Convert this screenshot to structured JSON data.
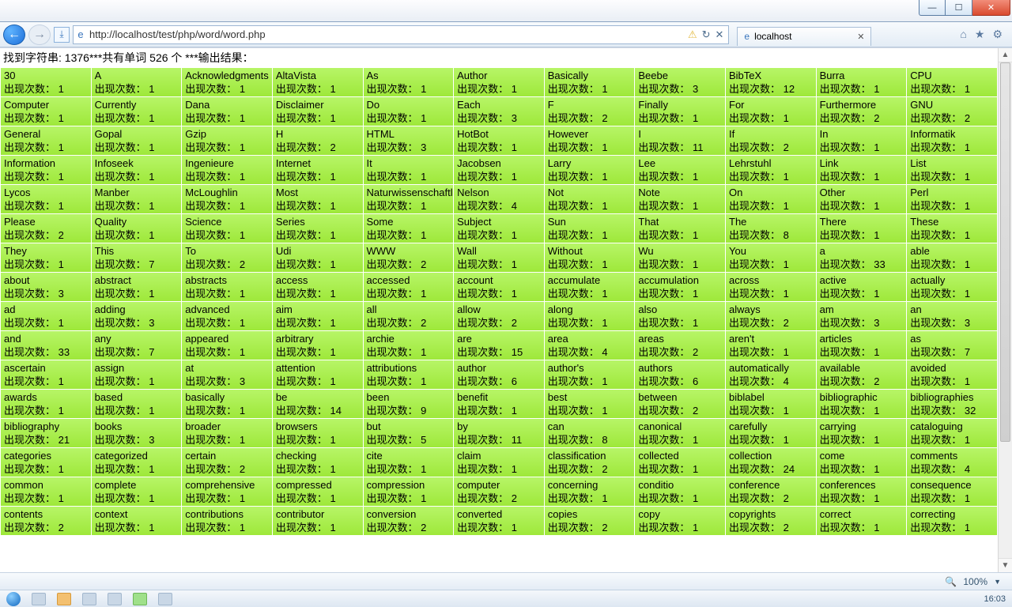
{
  "window": {
    "url": "http://localhost/test/php/word/word.php",
    "tab_title": "localhost",
    "zoom": "100%",
    "time": "16:03"
  },
  "page": {
    "header_prefix": "找到字符串: ",
    "char_count": "1376",
    "mid1": "***共有单词 ",
    "word_count": "526",
    "mid2": " 个 ***输出结果：",
    "count_label": "出现次数："
  },
  "words": [
    {
      "w": "30",
      "c": 1
    },
    {
      "w": "A",
      "c": 1
    },
    {
      "w": "Acknowledgments",
      "c": 1
    },
    {
      "w": "AltaVista",
      "c": 1
    },
    {
      "w": "As",
      "c": 1
    },
    {
      "w": "Author",
      "c": 1
    },
    {
      "w": "Basically",
      "c": 1
    },
    {
      "w": "Beebe",
      "c": 3
    },
    {
      "w": "BibTeX",
      "c": 12
    },
    {
      "w": "Burra",
      "c": 1
    },
    {
      "w": "CPU",
      "c": 1
    },
    {
      "w": "Computer",
      "c": 1
    },
    {
      "w": "Currently",
      "c": 1
    },
    {
      "w": "Dana",
      "c": 1
    },
    {
      "w": "Disclaimer",
      "c": 1
    },
    {
      "w": "Do",
      "c": 1
    },
    {
      "w": "Each",
      "c": 3
    },
    {
      "w": "F",
      "c": 2
    },
    {
      "w": "Finally",
      "c": 1
    },
    {
      "w": "For",
      "c": 1
    },
    {
      "w": "Furthermore",
      "c": 2
    },
    {
      "w": "GNU",
      "c": 2
    },
    {
      "w": "General",
      "c": 1
    },
    {
      "w": "Gopal",
      "c": 1
    },
    {
      "w": "Gzip",
      "c": 1
    },
    {
      "w": "H",
      "c": 2
    },
    {
      "w": "HTML",
      "c": 3
    },
    {
      "w": "HotBot",
      "c": 1
    },
    {
      "w": "However",
      "c": 1
    },
    {
      "w": "I",
      "c": 11
    },
    {
      "w": "If",
      "c": 2
    },
    {
      "w": "In",
      "c": 1
    },
    {
      "w": "Informatik",
      "c": 1
    },
    {
      "w": "Information",
      "c": 1
    },
    {
      "w": "Infoseek",
      "c": 1
    },
    {
      "w": "Ingenieure",
      "c": 1
    },
    {
      "w": "Internet",
      "c": 1
    },
    {
      "w": "It",
      "c": 1
    },
    {
      "w": "Jacobsen",
      "c": 1
    },
    {
      "w": "Larry",
      "c": 1
    },
    {
      "w": "Lee",
      "c": 1
    },
    {
      "w": "Lehrstuhl",
      "c": 1
    },
    {
      "w": "Link",
      "c": 1
    },
    {
      "w": "List",
      "c": 1
    },
    {
      "w": "Lycos",
      "c": 1
    },
    {
      "w": "Manber",
      "c": 1
    },
    {
      "w": "McLoughlin",
      "c": 1
    },
    {
      "w": "Most",
      "c": 1
    },
    {
      "w": "Naturwissenschaftler",
      "c": 1
    },
    {
      "w": "Nelson",
      "c": 4
    },
    {
      "w": "Not",
      "c": 1
    },
    {
      "w": "Note",
      "c": 1
    },
    {
      "w": "On",
      "c": 1
    },
    {
      "w": "Other",
      "c": 1
    },
    {
      "w": "Perl",
      "c": 1
    },
    {
      "w": "Please",
      "c": 2
    },
    {
      "w": "Quality",
      "c": 1
    },
    {
      "w": "Science",
      "c": 1
    },
    {
      "w": "Series",
      "c": 1
    },
    {
      "w": "Some",
      "c": 1
    },
    {
      "w": "Subject",
      "c": 1
    },
    {
      "w": "Sun",
      "c": 1
    },
    {
      "w": "That",
      "c": 1
    },
    {
      "w": "The",
      "c": 8
    },
    {
      "w": "There",
      "c": 1
    },
    {
      "w": "These",
      "c": 1
    },
    {
      "w": "They",
      "c": 1
    },
    {
      "w": "This",
      "c": 7
    },
    {
      "w": "To",
      "c": 2
    },
    {
      "w": "Udi",
      "c": 1
    },
    {
      "w": "WWW",
      "c": 2
    },
    {
      "w": "Wall",
      "c": 1
    },
    {
      "w": "Without",
      "c": 1
    },
    {
      "w": "Wu",
      "c": 1
    },
    {
      "w": "You",
      "c": 1
    },
    {
      "w": "a",
      "c": 33
    },
    {
      "w": "able",
      "c": 1
    },
    {
      "w": "about",
      "c": 3
    },
    {
      "w": "abstract",
      "c": 1
    },
    {
      "w": "abstracts",
      "c": 1
    },
    {
      "w": "access",
      "c": 1
    },
    {
      "w": "accessed",
      "c": 1
    },
    {
      "w": "account",
      "c": 1
    },
    {
      "w": "accumulate",
      "c": 1
    },
    {
      "w": "accumulation",
      "c": 1
    },
    {
      "w": "across",
      "c": 1
    },
    {
      "w": "active",
      "c": 1
    },
    {
      "w": "actually",
      "c": 1
    },
    {
      "w": "ad",
      "c": 1
    },
    {
      "w": "adding",
      "c": 3
    },
    {
      "w": "advanced",
      "c": 1
    },
    {
      "w": "aim",
      "c": 1
    },
    {
      "w": "all",
      "c": 2
    },
    {
      "w": "allow",
      "c": 2
    },
    {
      "w": "along",
      "c": 1
    },
    {
      "w": "also",
      "c": 1
    },
    {
      "w": "always",
      "c": 2
    },
    {
      "w": "am",
      "c": 3
    },
    {
      "w": "an",
      "c": 3
    },
    {
      "w": "and",
      "c": 33
    },
    {
      "w": "any",
      "c": 7
    },
    {
      "w": "appeared",
      "c": 1
    },
    {
      "w": "arbitrary",
      "c": 1
    },
    {
      "w": "archie",
      "c": 1
    },
    {
      "w": "are",
      "c": 15
    },
    {
      "w": "area",
      "c": 4
    },
    {
      "w": "areas",
      "c": 2
    },
    {
      "w": "aren't",
      "c": 1
    },
    {
      "w": "articles",
      "c": 1
    },
    {
      "w": "as",
      "c": 7
    },
    {
      "w": "ascertain",
      "c": 1
    },
    {
      "w": "assign",
      "c": 1
    },
    {
      "w": "at",
      "c": 3
    },
    {
      "w": "attention",
      "c": 1
    },
    {
      "w": "attributions",
      "c": 1
    },
    {
      "w": "author",
      "c": 6
    },
    {
      "w": "author's",
      "c": 1
    },
    {
      "w": "authors",
      "c": 6
    },
    {
      "w": "automatically",
      "c": 4
    },
    {
      "w": "available",
      "c": 2
    },
    {
      "w": "avoided",
      "c": 1
    },
    {
      "w": "awards",
      "c": 1
    },
    {
      "w": "based",
      "c": 1
    },
    {
      "w": "basically",
      "c": 1
    },
    {
      "w": "be",
      "c": 14
    },
    {
      "w": "been",
      "c": 9
    },
    {
      "w": "benefit",
      "c": 1
    },
    {
      "w": "best",
      "c": 1
    },
    {
      "w": "between",
      "c": 2
    },
    {
      "w": "biblabel",
      "c": 1
    },
    {
      "w": "bibliographic",
      "c": 1
    },
    {
      "w": "bibliographies",
      "c": 32
    },
    {
      "w": "bibliography",
      "c": 21
    },
    {
      "w": "books",
      "c": 3
    },
    {
      "w": "broader",
      "c": 1
    },
    {
      "w": "browsers",
      "c": 1
    },
    {
      "w": "but",
      "c": 5
    },
    {
      "w": "by",
      "c": 11
    },
    {
      "w": "can",
      "c": 8
    },
    {
      "w": "canonical",
      "c": 1
    },
    {
      "w": "carefully",
      "c": 1
    },
    {
      "w": "carrying",
      "c": 1
    },
    {
      "w": "cataloguing",
      "c": 1
    },
    {
      "w": "categories",
      "c": 1
    },
    {
      "w": "categorized",
      "c": 1
    },
    {
      "w": "certain",
      "c": 2
    },
    {
      "w": "checking",
      "c": 1
    },
    {
      "w": "cite",
      "c": 1
    },
    {
      "w": "claim",
      "c": 1
    },
    {
      "w": "classification",
      "c": 2
    },
    {
      "w": "collected",
      "c": 1
    },
    {
      "w": "collection",
      "c": 24
    },
    {
      "w": "come",
      "c": 1
    },
    {
      "w": "comments",
      "c": 4
    },
    {
      "w": "common",
      "c": 1
    },
    {
      "w": "complete",
      "c": 1
    },
    {
      "w": "comprehensive",
      "c": 1
    },
    {
      "w": "compressed",
      "c": 1
    },
    {
      "w": "compression",
      "c": 1
    },
    {
      "w": "computer",
      "c": 2
    },
    {
      "w": "concerning",
      "c": 1
    },
    {
      "w": "conditio",
      "c": 1
    },
    {
      "w": "conference",
      "c": 2
    },
    {
      "w": "conferences",
      "c": 1
    },
    {
      "w": "consequence",
      "c": 1
    },
    {
      "w": "contents",
      "c": 2
    },
    {
      "w": "context",
      "c": 1
    },
    {
      "w": "contributions",
      "c": 1
    },
    {
      "w": "contributor",
      "c": 1
    },
    {
      "w": "conversion",
      "c": 2
    },
    {
      "w": "converted",
      "c": 1
    },
    {
      "w": "copies",
      "c": 2
    },
    {
      "w": "copy",
      "c": 1
    },
    {
      "w": "copyrights",
      "c": 2
    },
    {
      "w": "correct",
      "c": 1
    },
    {
      "w": "correcting",
      "c": 1
    }
  ]
}
